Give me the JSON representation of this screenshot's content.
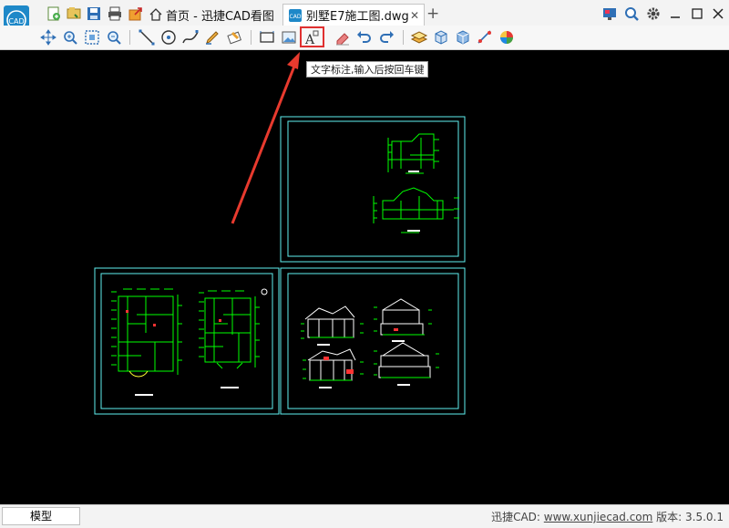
{
  "titlebar": {
    "home_tab_label": "首页 - 迅捷CAD看图",
    "doc_tab_label": "别墅E7施工图.dwg",
    "close_glyph": "✕",
    "add_glyph": "+"
  },
  "tooltip": {
    "text": "文字标注,输入后按回车键"
  },
  "statusbar": {
    "model_tab_label": "模型",
    "app_prefix": "迅捷CAD:",
    "url": "www.xunjiecad.com",
    "version_label": "版本: 3.5.0.1"
  },
  "logo": {
    "text": "CAD"
  },
  "colors": {
    "accent": "#1e88c8",
    "cad_green": "#00ff00",
    "cad_cyan": "#5ff0f0",
    "arrow_red": "#e83a2e"
  },
  "icons": {
    "quick": [
      "new-file-icon",
      "open-file-icon",
      "save-icon",
      "print-icon",
      "export-icon"
    ],
    "window": [
      "monitor-icon",
      "zoom-window-icon",
      "gear-icon",
      "minimize-icon",
      "maximize-icon",
      "close-icon"
    ],
    "toolbar": [
      "pan-icon",
      "zoom-icon",
      "zoom-extents-icon",
      "zoom-realtime-icon",
      "line-icon",
      "circle-icon",
      "polyline-icon",
      "pen-icon",
      "erase-mark-icon",
      "rectangle-icon",
      "image-icon",
      "text-annotation-icon",
      "eraser-icon",
      "undo-icon",
      "redo-icon",
      "layers-icon",
      "3d-box-icon",
      "3d-view-icon",
      "measure-icon",
      "color-icon"
    ]
  }
}
